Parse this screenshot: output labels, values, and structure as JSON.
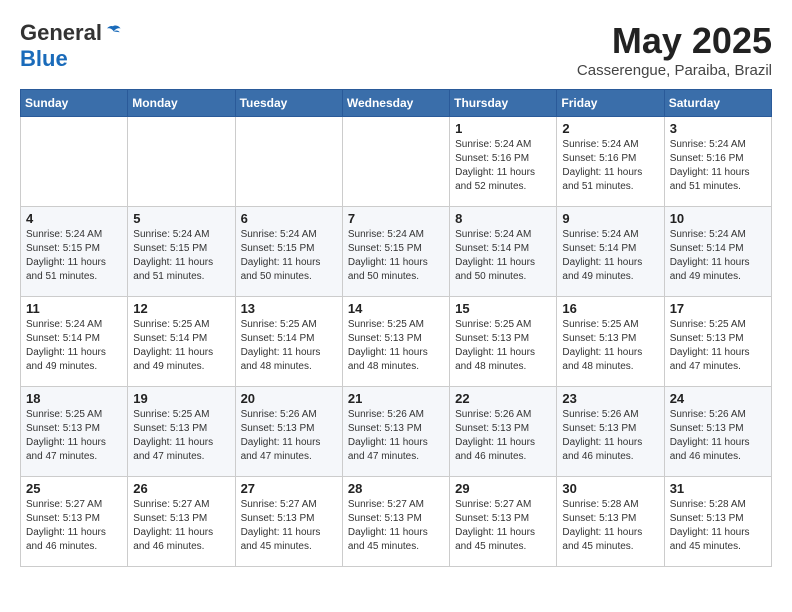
{
  "header": {
    "logo_general": "General",
    "logo_blue": "Blue",
    "month_year": "May 2025",
    "location": "Casserengue, Paraiba, Brazil"
  },
  "weekdays": [
    "Sunday",
    "Monday",
    "Tuesday",
    "Wednesday",
    "Thursday",
    "Friday",
    "Saturday"
  ],
  "weeks": [
    [
      {
        "day": "",
        "info": ""
      },
      {
        "day": "",
        "info": ""
      },
      {
        "day": "",
        "info": ""
      },
      {
        "day": "",
        "info": ""
      },
      {
        "day": "1",
        "info": "Sunrise: 5:24 AM\nSunset: 5:16 PM\nDaylight: 11 hours\nand 52 minutes."
      },
      {
        "day": "2",
        "info": "Sunrise: 5:24 AM\nSunset: 5:16 PM\nDaylight: 11 hours\nand 51 minutes."
      },
      {
        "day": "3",
        "info": "Sunrise: 5:24 AM\nSunset: 5:16 PM\nDaylight: 11 hours\nand 51 minutes."
      }
    ],
    [
      {
        "day": "4",
        "info": "Sunrise: 5:24 AM\nSunset: 5:15 PM\nDaylight: 11 hours\nand 51 minutes."
      },
      {
        "day": "5",
        "info": "Sunrise: 5:24 AM\nSunset: 5:15 PM\nDaylight: 11 hours\nand 51 minutes."
      },
      {
        "day": "6",
        "info": "Sunrise: 5:24 AM\nSunset: 5:15 PM\nDaylight: 11 hours\nand 50 minutes."
      },
      {
        "day": "7",
        "info": "Sunrise: 5:24 AM\nSunset: 5:15 PM\nDaylight: 11 hours\nand 50 minutes."
      },
      {
        "day": "8",
        "info": "Sunrise: 5:24 AM\nSunset: 5:14 PM\nDaylight: 11 hours\nand 50 minutes."
      },
      {
        "day": "9",
        "info": "Sunrise: 5:24 AM\nSunset: 5:14 PM\nDaylight: 11 hours\nand 49 minutes."
      },
      {
        "day": "10",
        "info": "Sunrise: 5:24 AM\nSunset: 5:14 PM\nDaylight: 11 hours\nand 49 minutes."
      }
    ],
    [
      {
        "day": "11",
        "info": "Sunrise: 5:24 AM\nSunset: 5:14 PM\nDaylight: 11 hours\nand 49 minutes."
      },
      {
        "day": "12",
        "info": "Sunrise: 5:25 AM\nSunset: 5:14 PM\nDaylight: 11 hours\nand 49 minutes."
      },
      {
        "day": "13",
        "info": "Sunrise: 5:25 AM\nSunset: 5:14 PM\nDaylight: 11 hours\nand 48 minutes."
      },
      {
        "day": "14",
        "info": "Sunrise: 5:25 AM\nSunset: 5:13 PM\nDaylight: 11 hours\nand 48 minutes."
      },
      {
        "day": "15",
        "info": "Sunrise: 5:25 AM\nSunset: 5:13 PM\nDaylight: 11 hours\nand 48 minutes."
      },
      {
        "day": "16",
        "info": "Sunrise: 5:25 AM\nSunset: 5:13 PM\nDaylight: 11 hours\nand 48 minutes."
      },
      {
        "day": "17",
        "info": "Sunrise: 5:25 AM\nSunset: 5:13 PM\nDaylight: 11 hours\nand 47 minutes."
      }
    ],
    [
      {
        "day": "18",
        "info": "Sunrise: 5:25 AM\nSunset: 5:13 PM\nDaylight: 11 hours\nand 47 minutes."
      },
      {
        "day": "19",
        "info": "Sunrise: 5:25 AM\nSunset: 5:13 PM\nDaylight: 11 hours\nand 47 minutes."
      },
      {
        "day": "20",
        "info": "Sunrise: 5:26 AM\nSunset: 5:13 PM\nDaylight: 11 hours\nand 47 minutes."
      },
      {
        "day": "21",
        "info": "Sunrise: 5:26 AM\nSunset: 5:13 PM\nDaylight: 11 hours\nand 47 minutes."
      },
      {
        "day": "22",
        "info": "Sunrise: 5:26 AM\nSunset: 5:13 PM\nDaylight: 11 hours\nand 46 minutes."
      },
      {
        "day": "23",
        "info": "Sunrise: 5:26 AM\nSunset: 5:13 PM\nDaylight: 11 hours\nand 46 minutes."
      },
      {
        "day": "24",
        "info": "Sunrise: 5:26 AM\nSunset: 5:13 PM\nDaylight: 11 hours\nand 46 minutes."
      }
    ],
    [
      {
        "day": "25",
        "info": "Sunrise: 5:27 AM\nSunset: 5:13 PM\nDaylight: 11 hours\nand 46 minutes."
      },
      {
        "day": "26",
        "info": "Sunrise: 5:27 AM\nSunset: 5:13 PM\nDaylight: 11 hours\nand 46 minutes."
      },
      {
        "day": "27",
        "info": "Sunrise: 5:27 AM\nSunset: 5:13 PM\nDaylight: 11 hours\nand 45 minutes."
      },
      {
        "day": "28",
        "info": "Sunrise: 5:27 AM\nSunset: 5:13 PM\nDaylight: 11 hours\nand 45 minutes."
      },
      {
        "day": "29",
        "info": "Sunrise: 5:27 AM\nSunset: 5:13 PM\nDaylight: 11 hours\nand 45 minutes."
      },
      {
        "day": "30",
        "info": "Sunrise: 5:28 AM\nSunset: 5:13 PM\nDaylight: 11 hours\nand 45 minutes."
      },
      {
        "day": "31",
        "info": "Sunrise: 5:28 AM\nSunset: 5:13 PM\nDaylight: 11 hours\nand 45 minutes."
      }
    ]
  ]
}
